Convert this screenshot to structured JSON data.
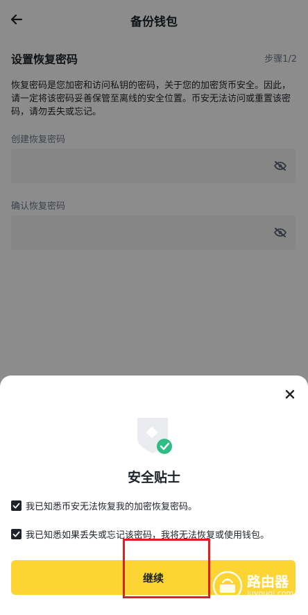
{
  "header": {
    "title": "备份钱包",
    "back_icon": "arrow-left-icon"
  },
  "section": {
    "title": "设置恢复密码",
    "step": "步骤1/2"
  },
  "description": "恢复密码是您加密和访问私钥的密码，关于您的加密货币安全。因此，请一定将该密码妥善保管至离线的安全位置。币安无法访问或重置该密码，请勿丢失或忘记。",
  "fields": [
    {
      "label": "创建恢复密码",
      "value": ""
    },
    {
      "label": "确认恢复密码",
      "value": ""
    }
  ],
  "sheet": {
    "title": "安全贴士",
    "checks": [
      {
        "label": "我已知悉币安无法恢复我的加密恢复密码。",
        "checked": true
      },
      {
        "label": "我已知悉如果丢失或忘记该密码，我将无法恢复或使用钱包。",
        "checked": true
      }
    ],
    "button_label": "继续"
  },
  "watermark": {
    "name": "路由器",
    "url": "luyouqi.com"
  },
  "colors": {
    "accent": "#fcd535",
    "success": "#2ebd85",
    "annotation": "#e02020"
  }
}
